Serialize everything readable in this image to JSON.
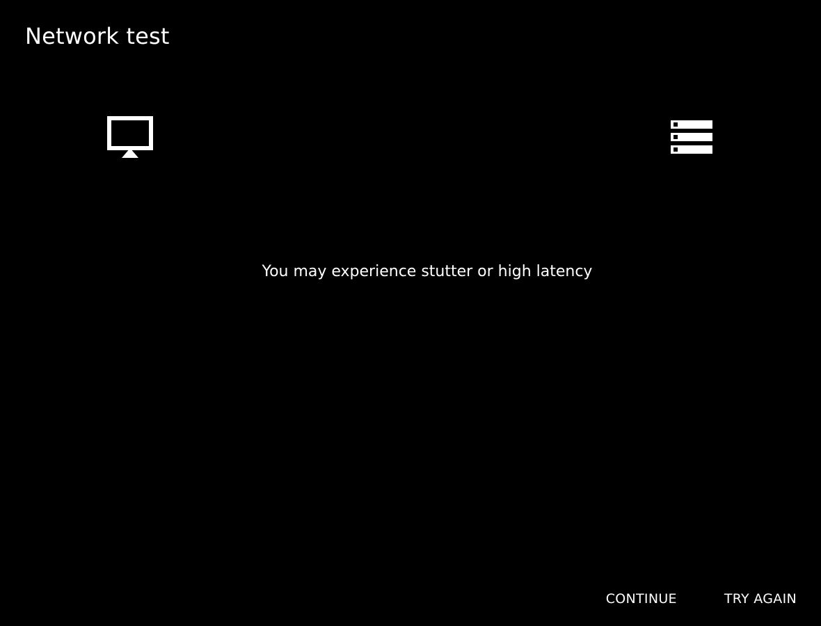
{
  "header": {
    "title": "Network test"
  },
  "diagram": {
    "left_icon": "monitor-icon",
    "right_icon": "server-icon"
  },
  "result": {
    "message": "You may experience stutter or high latency"
  },
  "actions": {
    "continue_label": "CONTINUE",
    "try_again_label": "TRY AGAIN"
  },
  "colors": {
    "background": "#000000",
    "foreground": "#ffffff"
  }
}
